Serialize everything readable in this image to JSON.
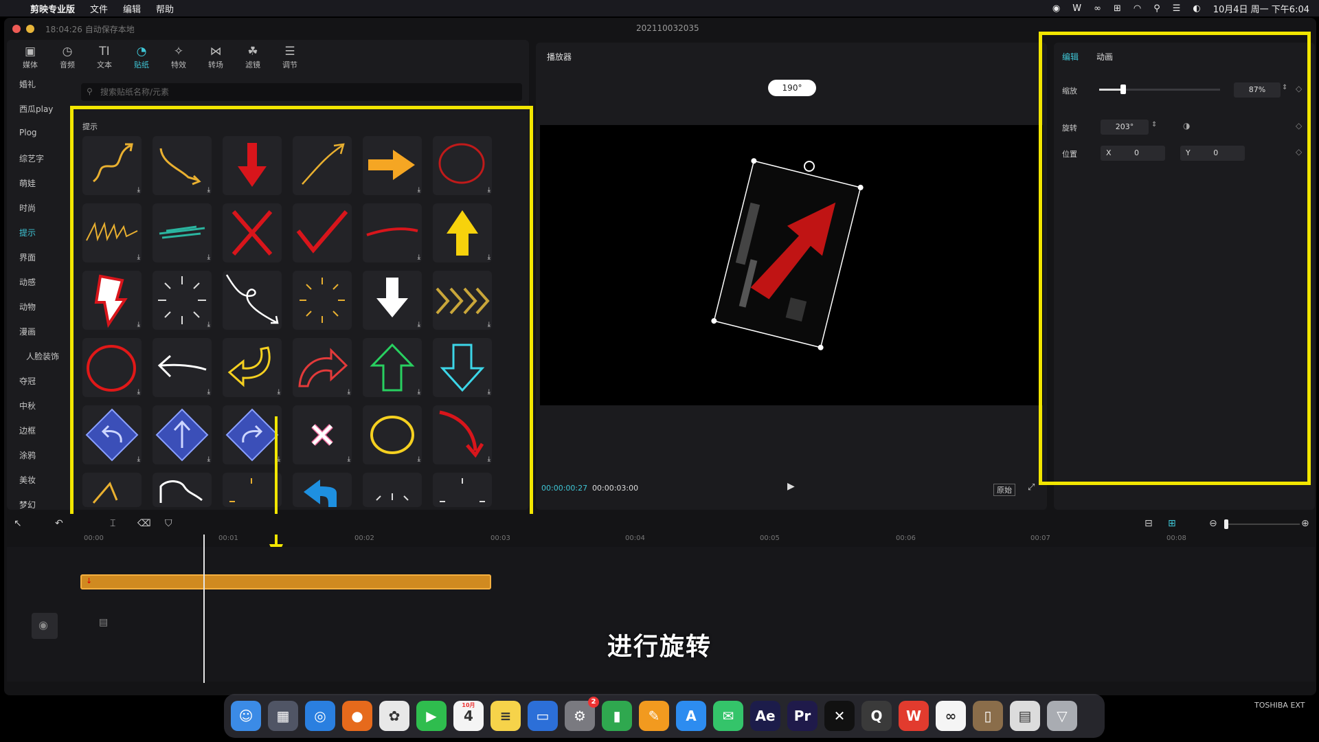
{
  "menubar": {
    "apple": "",
    "app_name": "剪映专业版",
    "menus": [
      "文件",
      "编辑",
      "帮助"
    ],
    "datetime": "10月4日 周一 下午6:04"
  },
  "window": {
    "autosave": "18:04:26 自动保存本地",
    "project_name": "202110032035"
  },
  "toolbar": {
    "items": [
      {
        "label": "媒体",
        "icon": "media-icon"
      },
      {
        "label": "音频",
        "icon": "audio-icon"
      },
      {
        "label": "文本",
        "icon": "text-icon"
      },
      {
        "label": "贴纸",
        "icon": "sticker-icon"
      },
      {
        "label": "特效",
        "icon": "effects-icon"
      },
      {
        "label": "转场",
        "icon": "transition-icon"
      },
      {
        "label": "滤镜",
        "icon": "filter-icon"
      },
      {
        "label": "调节",
        "icon": "adjust-icon"
      }
    ],
    "active": "贴纸"
  },
  "categories": {
    "items": [
      "婚礼",
      "西瓜play",
      "Plog",
      "综艺字",
      "萌娃",
      "时尚",
      "提示",
      "界面",
      "动感",
      "动物",
      "漫画",
      "人脸装饰",
      "夺冠",
      "中秋",
      "边框",
      "涂鸦",
      "美妆",
      "梦幻"
    ],
    "active": "提示"
  },
  "search": {
    "placeholder": "搜索贴纸名称/元素"
  },
  "sticker_section": {
    "title": "提示"
  },
  "player": {
    "title": "播放器",
    "rotation_badge": "190°",
    "current_time": "00:00:00:27",
    "total_time": "00:00:03:00",
    "ratio_button": "原始"
  },
  "inspector": {
    "tabs": [
      "编辑",
      "动画"
    ],
    "active_tab": "编辑",
    "scale_label": "缩放",
    "scale_value": "87%",
    "scale_fraction": 0.2,
    "rotate_label": "旋转",
    "rotate_value": "203°",
    "position_label": "位置",
    "pos_x_label": "X",
    "pos_x": "0",
    "pos_y_label": "Y",
    "pos_y": "0"
  },
  "timeline": {
    "ticks": [
      "00:00",
      "00:01",
      "00:02",
      "00:03",
      "00:04",
      "00:05",
      "00:06",
      "00:07",
      "00:08"
    ]
  },
  "subtitle": "进行旋转",
  "dock": {
    "apps": [
      {
        "name": "finder-icon",
        "glyph": "☺",
        "color": "#3b8be6"
      },
      {
        "name": "launchpad-icon",
        "glyph": "▦",
        "color": "#505565"
      },
      {
        "name": "safari-icon",
        "glyph": "◎",
        "color": "#2a7fe0"
      },
      {
        "name": "firefox-icon",
        "glyph": "●",
        "color": "#e66a1c"
      },
      {
        "name": "photos-icon",
        "glyph": "✿",
        "color": "#e8e8e8"
      },
      {
        "name": "facetime-icon",
        "glyph": "▶",
        "color": "#2fbd4e"
      },
      {
        "name": "calendar-icon",
        "glyph": "4",
        "color": "#f4f4f4"
      },
      {
        "name": "notes-icon",
        "glyph": "≡",
        "color": "#f6d34a"
      },
      {
        "name": "keynote-icon",
        "glyph": "▭",
        "color": "#2c6fd8"
      },
      {
        "name": "system-preferences-icon",
        "glyph": "⚙",
        "color": "#7a7a80"
      },
      {
        "name": "numbers-icon",
        "glyph": "▮",
        "color": "#2fa84f"
      },
      {
        "name": "pages-icon",
        "glyph": "✎",
        "color": "#f29a1f"
      },
      {
        "name": "app-store-icon",
        "glyph": "A",
        "color": "#2d8cf0"
      },
      {
        "name": "wechat-icon",
        "glyph": "✉",
        "color": "#34c46a"
      },
      {
        "name": "after-effects-icon",
        "glyph": "Ae",
        "color": "#1c1c4a"
      },
      {
        "name": "premiere-icon",
        "glyph": "Pr",
        "color": "#1f1a4a"
      },
      {
        "name": "capcut-icon",
        "glyph": "✕",
        "color": "#111111"
      },
      {
        "name": "quicktime-icon",
        "glyph": "Q",
        "color": "#3a3a3a"
      },
      {
        "name": "wps-icon",
        "glyph": "W",
        "color": "#e23b2e"
      },
      {
        "name": "baidu-netdisk-icon",
        "glyph": "∞",
        "color": "#f5f5f5"
      },
      {
        "name": "document-icon",
        "glyph": "▯",
        "color": "#8a6d4a"
      },
      {
        "name": "preview-icon",
        "glyph": "▤",
        "color": "#dcdcdc"
      },
      {
        "name": "trash-icon",
        "glyph": "▽",
        "color": "#a9acb2"
      }
    ],
    "calendar_month": "10月",
    "sysprefs_badge": "2"
  },
  "external_drive": "TOSHIBA EXT"
}
